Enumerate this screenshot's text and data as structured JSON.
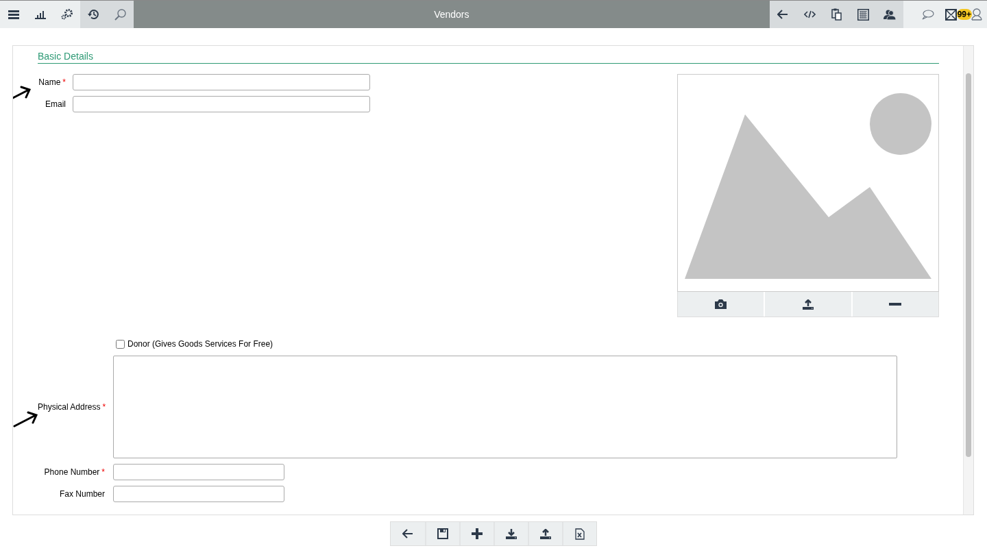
{
  "window": {
    "title": "Vendors"
  },
  "notifications": {
    "badge": "99+"
  },
  "required_mark": "*",
  "section": {
    "title": "Basic Details"
  },
  "top_fields": [
    {
      "label": "Name",
      "required": true
    },
    {
      "label": "Email",
      "required": false
    }
  ],
  "donor": {
    "label": "Donor (Gives Goods Services For Free)",
    "checked": false
  },
  "address": {
    "label": "Physical Address",
    "required": true
  },
  "contact_fields": [
    {
      "label": "Phone Number",
      "required": true
    },
    {
      "label": "Fax Number",
      "required": false
    }
  ]
}
